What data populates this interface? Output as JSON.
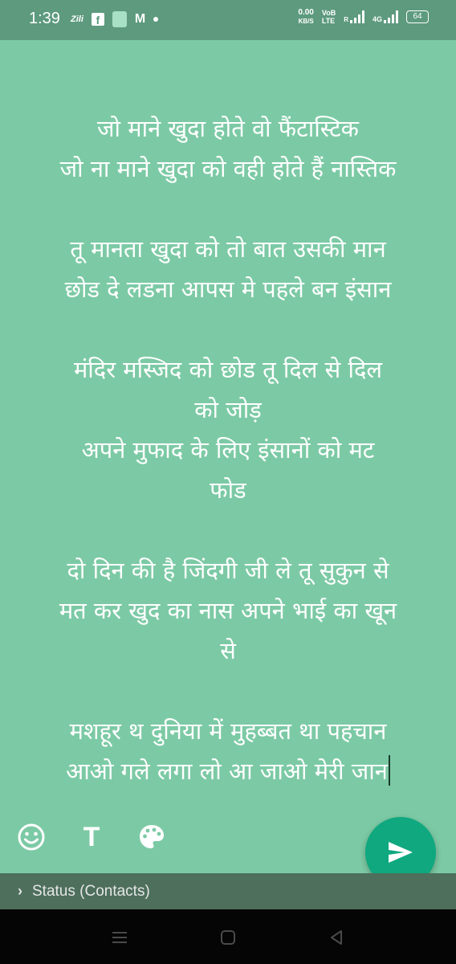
{
  "status_bar": {
    "time": "1:39",
    "notif_zili": "Zili",
    "notif_fb": "f",
    "notif_m": "M",
    "net_speed_value": "0.00",
    "net_speed_unit": "KB/S",
    "volte_top": "VoB",
    "volte_bottom": "LTE",
    "roaming": "R",
    "network": "4G",
    "battery": "64"
  },
  "status_text": {
    "lines": [
      "जो माने खुदा होते वो फैंटास्टिक",
      "जो ना माने खुदा को वही होते हैं नास्तिक",
      "",
      "तू मानता खुदा को तो बात उसकी मान",
      "छोड दे लडना आपस मे पहले बन इंसान",
      "",
      "मंदिर मस्जिद को छोड तू दिल से दिल",
      "को जोड़",
      "अपने मुफाद के लिए इंसानों को मट",
      "फोड",
      "",
      "दो दिन की है जिंदगी जी ले तू सुकुन से",
      "मत कर खुद का नास अपने भाई का खून",
      "से",
      "",
      "मशहूर थ  दुनिया में मुहब्बत था पहचान",
      "आओ गले लगा लो आ जाओ मेरी जान"
    ]
  },
  "toolbar": {
    "text_tool_label": "T"
  },
  "recipient": {
    "chevron": "›",
    "label": "Status (Contacts)"
  },
  "colors": {
    "background": "#7ccaa5",
    "status_bar": "#5d9a7e",
    "fab": "#0fa87f",
    "recipient_bar": "#4d6f5c",
    "nav_bar": "#050505"
  },
  "icons": [
    "emoji-icon",
    "text-format-icon",
    "palette-icon",
    "send-icon",
    "menu-icon",
    "home-icon",
    "back-icon"
  ]
}
